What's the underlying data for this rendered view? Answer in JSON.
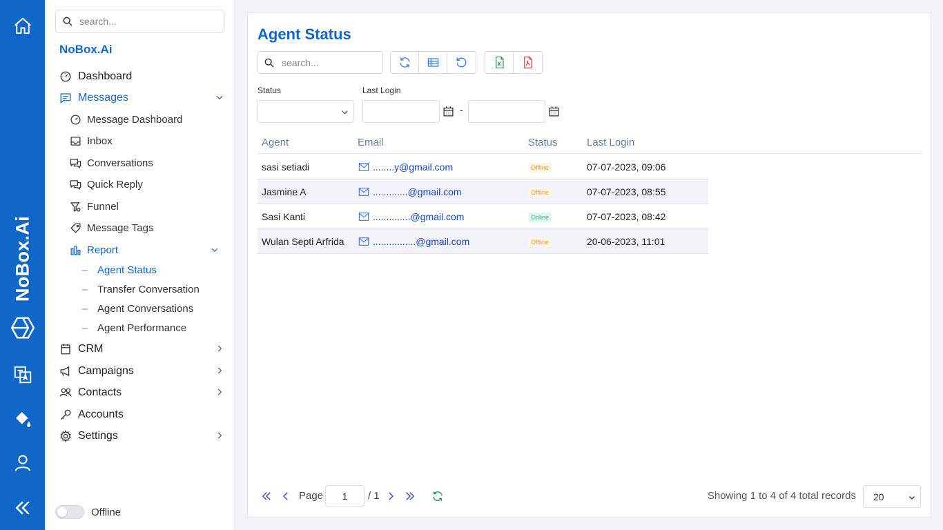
{
  "rail": {
    "brand": "NoBox.Ai",
    "icons": [
      "home-icon",
      "logo-cube-icon",
      "translate-icon",
      "paint-bucket-icon",
      "user-icon",
      "double-chevron-left-icon"
    ]
  },
  "sidebar": {
    "search_placeholder": "search...",
    "brand": "NoBox.Ai",
    "items": [
      {
        "label": "Dashboard",
        "icon": "gauge-icon"
      },
      {
        "label": "Messages",
        "icon": "message-icon"
      },
      {
        "label": "CRM",
        "icon": "crm-icon"
      },
      {
        "label": "Campaigns",
        "icon": "megaphone-icon"
      },
      {
        "label": "Contacts",
        "icon": "contacts-icon"
      },
      {
        "label": "Accounts",
        "icon": "key-icon"
      },
      {
        "label": "Settings",
        "icon": "gear-icon"
      }
    ],
    "messages_sub": [
      {
        "label": "Message Dashboard",
        "icon": "gauge-icon"
      },
      {
        "label": "Inbox",
        "icon": "inbox-icon"
      },
      {
        "label": "Conversations",
        "icon": "chat-icon"
      },
      {
        "label": "Quick Reply",
        "icon": "chat-icon"
      },
      {
        "label": "Funnel",
        "icon": "funnel-icon"
      },
      {
        "label": "Message Tags",
        "icon": "tag-icon"
      },
      {
        "label": "Report",
        "icon": "report-icon"
      }
    ],
    "report_sub": [
      {
        "label": "Agent Status"
      },
      {
        "label": "Transfer Conversation"
      },
      {
        "label": "Agent Conversations"
      },
      {
        "label": "Agent Performance"
      }
    ],
    "status_toggle_label": "Offline"
  },
  "main": {
    "title": "Agent Status",
    "search_placeholder": "search...",
    "filters": {
      "status_label": "Status",
      "last_login_label": "Last Login",
      "date_separator": "-"
    },
    "table": {
      "columns": [
        "Agent",
        "Email",
        "Status",
        "Last Login"
      ],
      "rows": [
        {
          "agent": "sasi setiadi",
          "email": "........y@gmail.com",
          "status": "Offline",
          "last_login": "07-07-2023, 09:06"
        },
        {
          "agent": "Jasmine A",
          "email": ".............@gmail.com",
          "status": "Offline",
          "last_login": "07-07-2023, 08:55"
        },
        {
          "agent": "Sasi Kanti",
          "email": "..............@gmail.com",
          "status": "Online",
          "last_login": "07-07-2023, 08:42"
        },
        {
          "agent": "Wulan Septi Arfrida",
          "email": "................@gmail.com",
          "status": "Offline",
          "last_login": "20-06-2023, 11:01"
        }
      ]
    },
    "pager": {
      "page_label": "Page",
      "current_page": "1",
      "total_pages": "/ 1",
      "records_text": "Showing 1 to 4 of 4 total records",
      "per_page": "20"
    }
  },
  "colors": {
    "accent": "#1167c8",
    "offline_badge": "#e0a22a",
    "online_badge": "#2bbd86"
  }
}
